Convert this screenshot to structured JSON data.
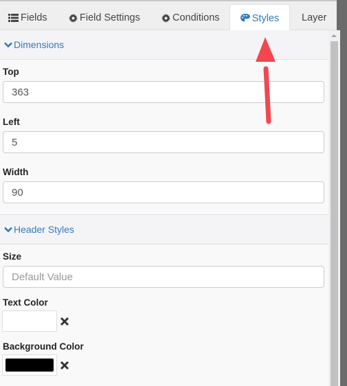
{
  "tabs": [
    {
      "label": "Fields",
      "icon": "list-icon",
      "active": false
    },
    {
      "label": "Field Settings",
      "icon": "gear-icon",
      "active": false
    },
    {
      "label": "Conditions",
      "icon": "gear-icon",
      "active": false
    },
    {
      "label": "Styles",
      "icon": "palette-icon",
      "active": true
    },
    {
      "label": "Layer",
      "icon": "",
      "active": false
    }
  ],
  "dimensions": {
    "heading": "Dimensions",
    "top_label": "Top",
    "top_value": "363",
    "left_label": "Left",
    "left_value": "5",
    "width_label": "Width",
    "width_value": "90"
  },
  "header_styles": {
    "heading": "Header Styles",
    "size_label": "Size",
    "size_placeholder": "Default Value",
    "text_color_label": "Text Color",
    "text_color": "#ffffff",
    "bg_color_label": "Background Color",
    "bg_color": "#000000"
  },
  "colors": {
    "accent": "#337ab7",
    "annotation_arrow": "#f2474f"
  }
}
